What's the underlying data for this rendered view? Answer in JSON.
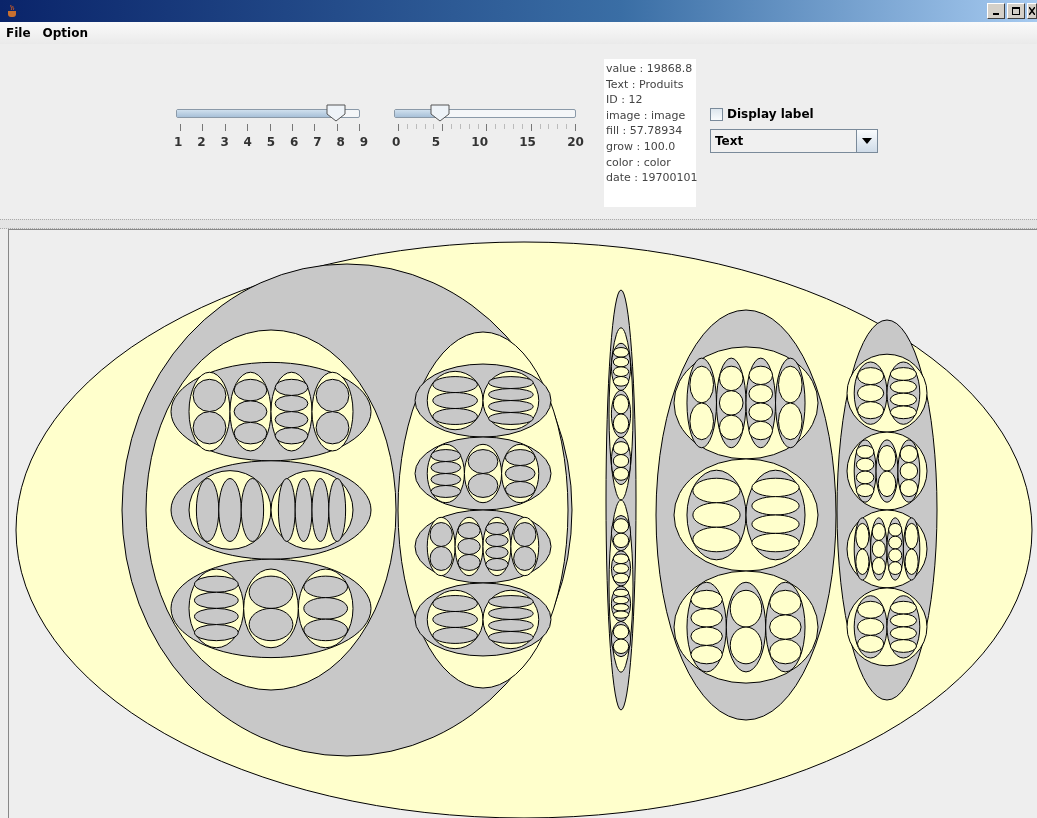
{
  "menu": [
    {
      "label": "File"
    },
    {
      "label": "Option"
    }
  ],
  "sliders": [
    {
      "level": 0.875,
      "labels": [
        "1",
        "2",
        "3",
        "4",
        "5",
        "6",
        "7",
        "8",
        "9"
      ]
    },
    {
      "level": 0.25,
      "labels": [
        "0",
        "5",
        "10",
        "15",
        "20"
      ]
    }
  ],
  "info": [
    "value : 19868.8",
    "Text : Produits",
    "ID : 12",
    "image : image",
    "fill : 57.78934",
    "grow : 100.0",
    "color : color",
    "date : 19700101"
  ],
  "display_label": {
    "label": "Display label",
    "checked": false
  },
  "combo": {
    "value": "Text"
  }
}
